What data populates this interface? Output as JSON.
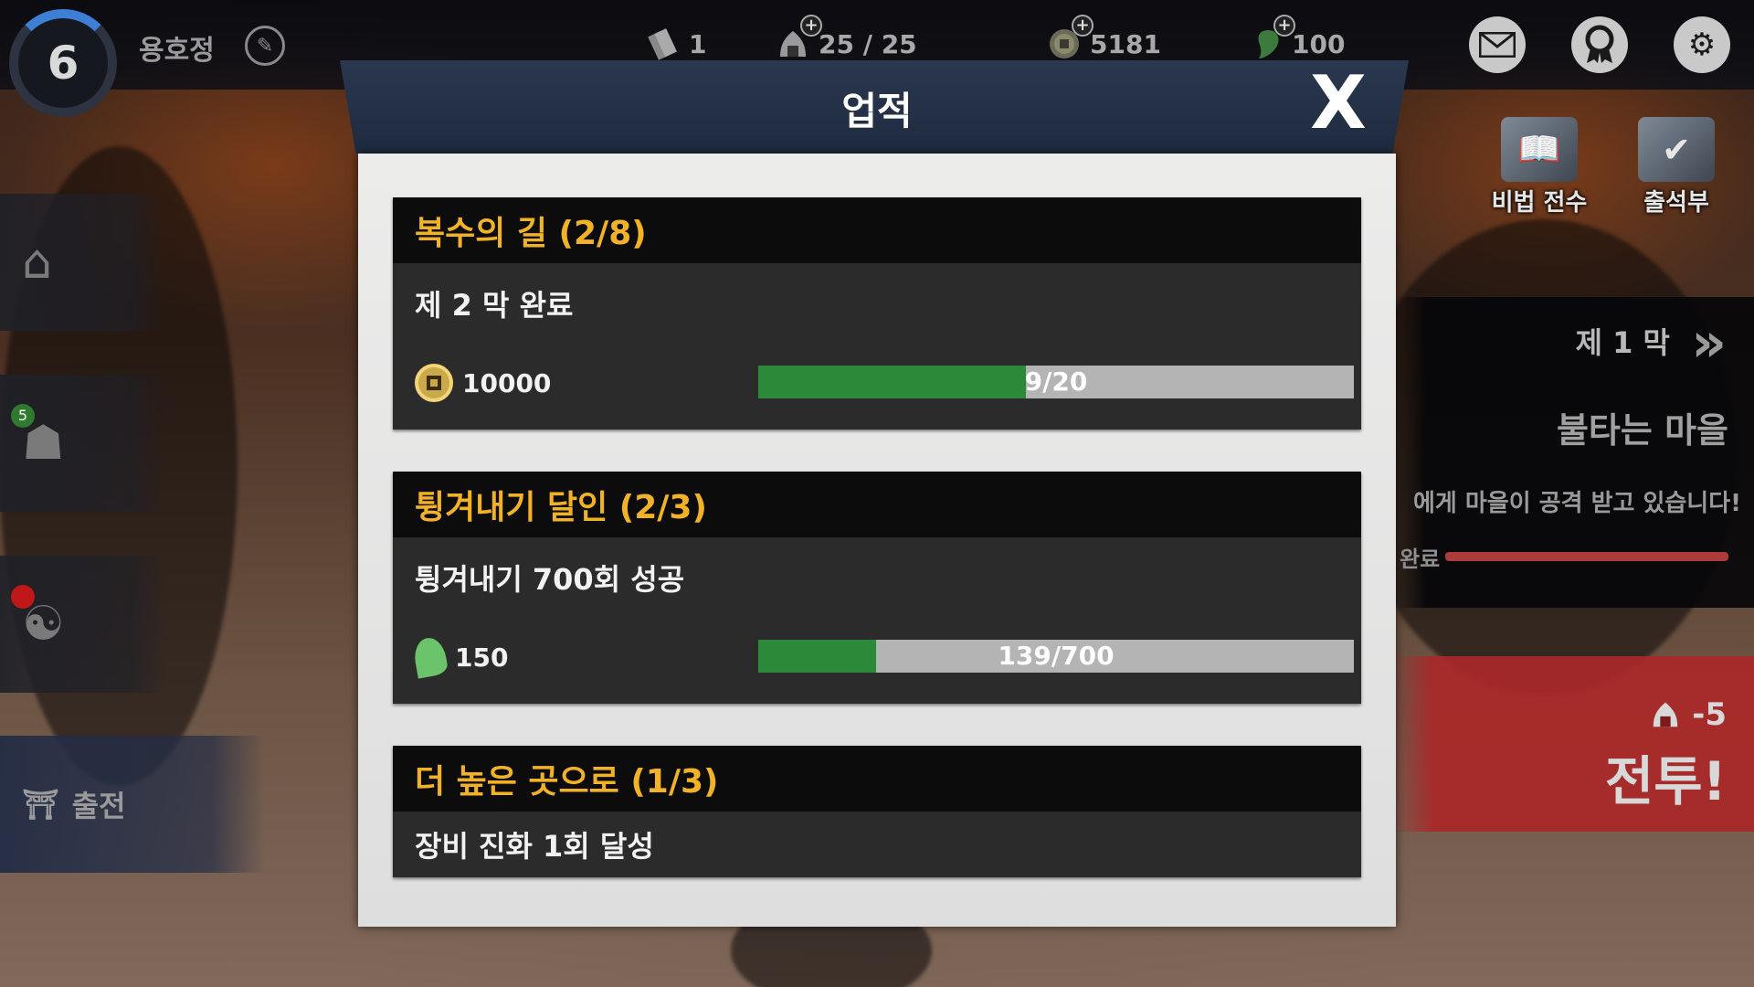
{
  "player": {
    "level": "6",
    "name": "용호정"
  },
  "resources": {
    "tickets": "1",
    "stamina": "25 / 25",
    "coins": "5181",
    "jade": "100"
  },
  "side_menu": {
    "badge_count": "5",
    "sortie_label": "출전"
  },
  "right_shortcuts": {
    "secret_label": "비법 전수",
    "attendance_label": "출석부"
  },
  "stage": {
    "act": "제 1 막",
    "name": "불타는 마을",
    "description": "에게 마을이 공격 받고 있습니다!",
    "progress_label": "완료"
  },
  "battle": {
    "cost": "-5",
    "label": "전투!"
  },
  "modal": {
    "title": "업적",
    "close_icon": "X"
  },
  "achievements": [
    {
      "title": "복수의 길 (2/8)",
      "description": "제 2 막 완료",
      "reward_type": "coin",
      "reward": "10000",
      "progress_text": "9/20",
      "progress_value": 9,
      "progress_max": 20
    },
    {
      "title": "튕겨내기 달인 (2/3)",
      "description": "튕겨내기 700회 성공",
      "reward_type": "jade",
      "reward": "150",
      "progress_text": "139/700",
      "progress_value": 139,
      "progress_max": 700
    },
    {
      "title": "더 높은 곳으로 (1/3)",
      "description": "장비 진화 1회 달성"
    }
  ],
  "colors": {
    "title_gold": "#f2b228",
    "progress_green": "#2a8a3a",
    "progress_track": "#b4b4b4",
    "battle_red": "#aa2828"
  }
}
